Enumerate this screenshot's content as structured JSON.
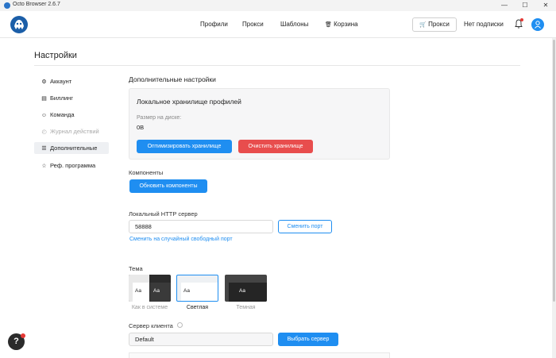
{
  "window": {
    "title": "Octo Browser 2.6.7",
    "minimize": "—",
    "maximize": "☐",
    "close": "✕"
  },
  "header": {
    "nav": [
      "Профили",
      "Прокси",
      "Шаблоны",
      "Корзина"
    ],
    "proxy_button": "Прокси",
    "subscription": "Нет подписки"
  },
  "page": {
    "title": "Настройки"
  },
  "sidebar": {
    "items": [
      {
        "label": "Аккаунт",
        "icon": "gear-icon"
      },
      {
        "label": "Биллинг",
        "icon": "receipt-icon"
      },
      {
        "label": "Команда",
        "icon": "team-icon"
      },
      {
        "label": "Журнал действий",
        "icon": "history-icon"
      },
      {
        "label": "Дополнительные",
        "icon": "sliders-icon"
      },
      {
        "label": "Реф. программа",
        "icon": "star-icon"
      }
    ]
  },
  "main": {
    "section_title": "Дополнительные настройки",
    "storage": {
      "title": "Локальное хранилище профилей",
      "size_label": "Размер на диске:",
      "size_value": "0B",
      "optimize_button": "Оптимизировать хранилище",
      "clear_button": "Очистить хранилище"
    },
    "components": {
      "label": "Компоненты",
      "update_button": "Обновить компоненты"
    },
    "http_server": {
      "label": "Локальный HTTP сервер",
      "port_value": "58888",
      "change_port_button": "Сменить порт",
      "random_port_link": "Сменить на случайный свободный порт"
    },
    "theme": {
      "label": "Тема",
      "sample_text": "Aa",
      "options": [
        "Как в системе",
        "Светлая",
        "Темная"
      ],
      "selected": "Светлая"
    },
    "client_server": {
      "label": "Сервер клиента",
      "value": "Default",
      "select_button": "Выбрать сервер"
    }
  },
  "help": {
    "label": "?"
  },
  "colors": {
    "accent": "#1f8ef1",
    "danger": "#e84d4d"
  }
}
